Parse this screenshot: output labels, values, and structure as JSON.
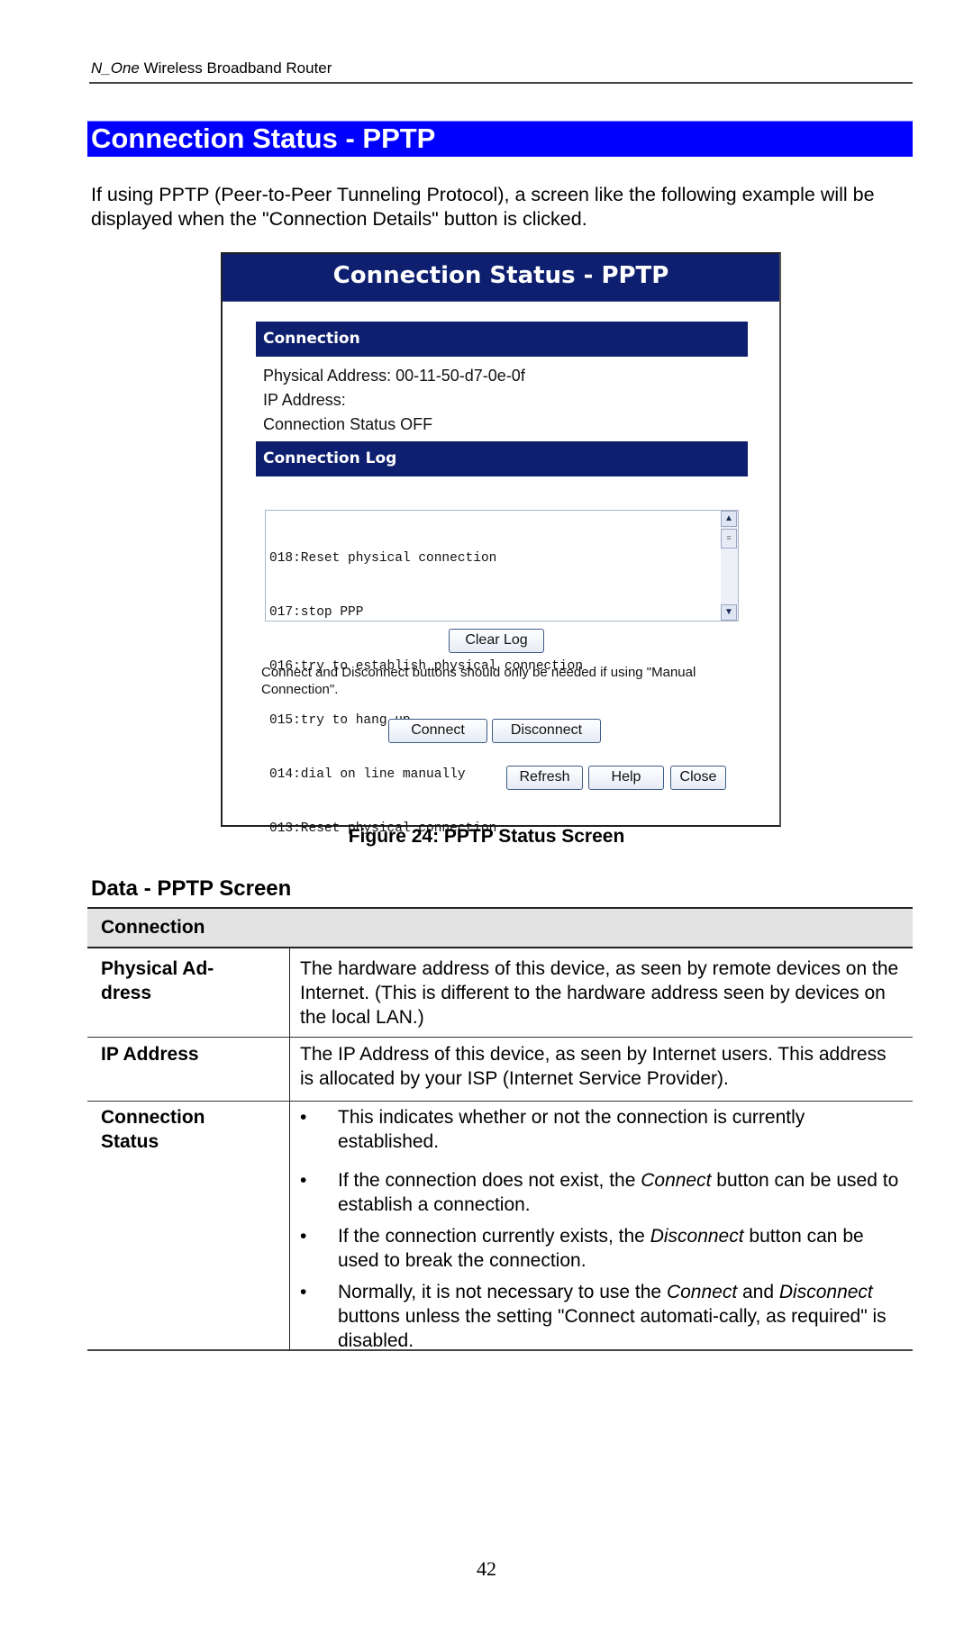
{
  "running_header": {
    "product_italic": "N_One",
    "product_rest": " Wireless Broadband Router"
  },
  "section_title": "Connection Status - PPTP",
  "intro": "If using PPTP (Peer-to-Peer Tunneling Protocol), a screen like the following example will be displayed when the \"Connection Details\" button is clicked.",
  "figure": {
    "window_title": "Connection Status - PPTP",
    "connection_section": "Connection",
    "physical_address": "Physical Address: 00-11-50-d7-0e-0f",
    "ip_address": "IP Address:",
    "connection_status": "Connection Status OFF",
    "log_section": "Connection Log",
    "log_lines": [
      "018:Reset physical connection",
      "017:stop PPP",
      "016:try to establish physical connection",
      "015:try to hang up",
      "014:dial on line manually",
      "013:Reset physical connection"
    ],
    "scroll_up_icon": "▲",
    "scroll_down_icon": "▼",
    "scroll_thumb_icon": "≡",
    "clear_log_label": "Clear Log",
    "note": "Connect and Disconnect buttons should only be needed if using \"Manual Connection\".",
    "connect_label": "Connect",
    "disconnect_label": "Disconnect",
    "refresh_label": "Refresh",
    "help_label": "Help",
    "close_label": "Close"
  },
  "caption": "Figure 24: PPTP Status Screen",
  "subheading": "Data - PPTP Screen",
  "table": {
    "header": "Connection",
    "rows": [
      {
        "label": "Physical Ad-\ndress",
        "desc": "The hardware address of this device, as seen by remote devices on the Internet. (This is different to the hardware address seen by devices on the local LAN.)"
      },
      {
        "label": "IP Address",
        "desc": "The IP Address of this device, as seen by Internet users. This address is allocated by your ISP (Internet Service Provider)."
      },
      {
        "label": "Connection Status",
        "bullets": [
          {
            "before": "This indicates whether or not the connection is currently established.",
            "em": "",
            "after": ""
          },
          {
            "before": "If the connection does not exist, the ",
            "em": "Connect",
            "after": " button can be used to establish a connection."
          },
          {
            "before": "If the connection currently exists, the ",
            "em": "Disconnect",
            "after": " button can be used to break the connection."
          },
          {
            "before": "Normally, it is not necessary to use the ",
            "em": "Connect",
            "mid": " and ",
            "em2": "Disconnect",
            "after": " buttons unless the setting \"Connect automati-cally, as required\" is disabled."
          }
        ]
      }
    ]
  },
  "bullet_glyph": "•",
  "page_number": "42"
}
